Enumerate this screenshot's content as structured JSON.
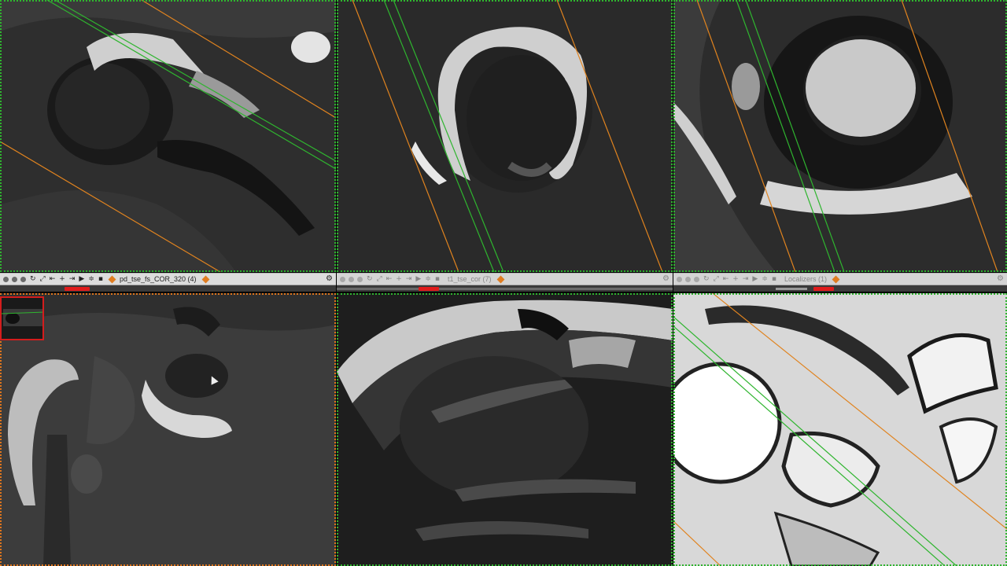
{
  "viewers": [
    {
      "id": "axial-top-left",
      "title": "pd_tse_fs_COR_320 (4)",
      "active": true
    },
    {
      "id": "coronal-top-middle",
      "title": "t1_tse_cor (7)",
      "active": false
    },
    {
      "id": "sagittal-top-right",
      "title": "Localizers (1)",
      "active": false
    }
  ],
  "colors": {
    "reference_line_green": "#2fb52f",
    "reference_line_orange": "#e0831f",
    "active_border": "#e0761d",
    "scroll_thumb": "#e01b1b"
  },
  "icons": [
    "close-dot-icon",
    "minimize-dot-icon",
    "zoom-dot-icon",
    "rotate-icon",
    "fullscreen-icon",
    "first-frame-icon",
    "crosshair-icon",
    "last-frame-icon",
    "play-icon",
    "stack-icon",
    "save-icon",
    "series-diamond-icon",
    "gear-icon"
  ]
}
